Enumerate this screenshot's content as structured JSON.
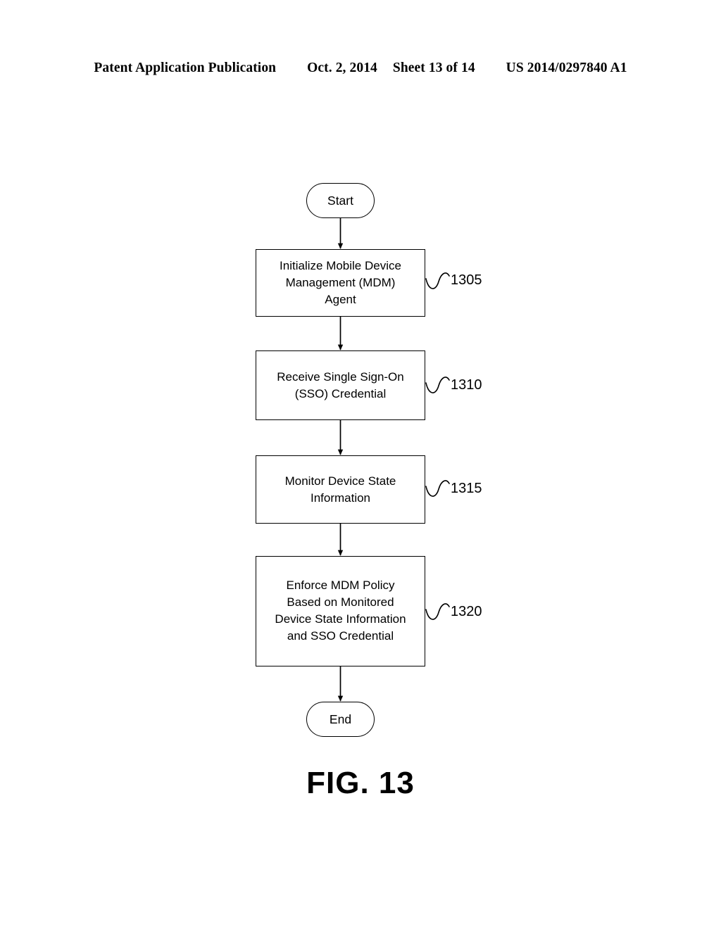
{
  "header": {
    "publication": "Patent Application Publication",
    "date": "Oct. 2, 2014",
    "sheet": "Sheet 13 of 14",
    "patent_number": "US 2014/0297840 A1"
  },
  "figure": {
    "caption": "FIG. 13",
    "type": "flowchart",
    "line_color": "#000000",
    "background": "#ffffff"
  },
  "flowchart": {
    "nodes": [
      {
        "id": "start",
        "shape": "terminator",
        "label": "Start",
        "ref": null
      },
      {
        "id": "step-1305",
        "shape": "process",
        "label": "Initialize Mobile Device\nManagement (MDM)\nAgent",
        "ref": "1305"
      },
      {
        "id": "step-1310",
        "shape": "process",
        "label": "Receive Single Sign-On\n(SSO) Credential",
        "ref": "1310"
      },
      {
        "id": "step-1315",
        "shape": "process",
        "label": "Monitor Device State\nInformation",
        "ref": "1315"
      },
      {
        "id": "step-1320",
        "shape": "process",
        "label": "Enforce MDM Policy\nBased on Monitored\nDevice State Information\nand SSO Credential",
        "ref": "1320"
      },
      {
        "id": "end",
        "shape": "terminator",
        "label": "End",
        "ref": null
      }
    ],
    "edges": [
      {
        "from": "start",
        "to": "step-1305",
        "arrow": true
      },
      {
        "from": "step-1305",
        "to": "step-1310",
        "arrow": true
      },
      {
        "from": "step-1310",
        "to": "step-1315",
        "arrow": true
      },
      {
        "from": "step-1315",
        "to": "step-1320",
        "arrow": true
      },
      {
        "from": "step-1320",
        "to": "end",
        "arrow": true
      }
    ]
  }
}
